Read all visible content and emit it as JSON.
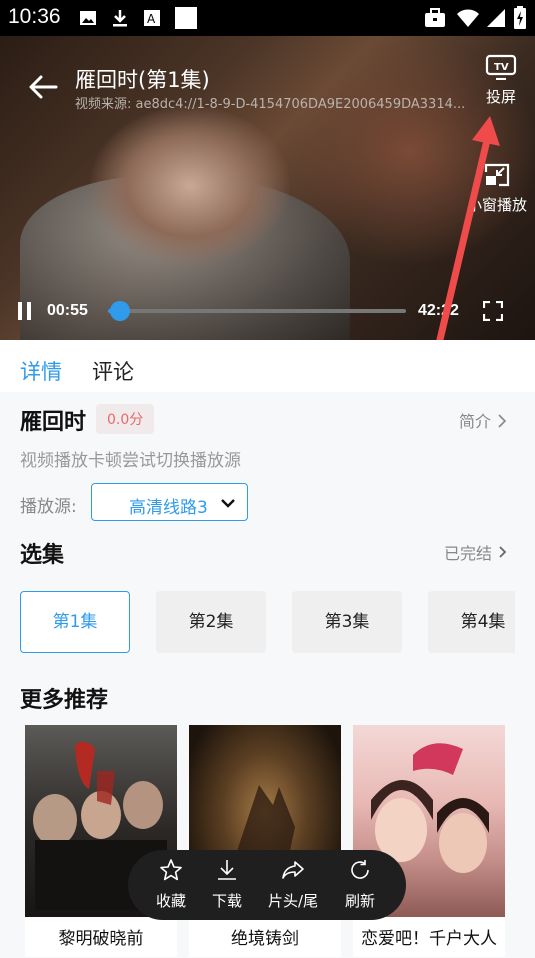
{
  "status_bar": {
    "time": "10:36"
  },
  "player": {
    "title": "雁回时(第1集)",
    "source_text": "视频来源:  ae8dc4://1-8-9-D-4154706DA9E2006459DA3314...",
    "cast_label": "投屏",
    "float_label": "小窗播放",
    "current_time": "00:55",
    "duration": "42:22",
    "progress_fraction": 0.04
  },
  "tabs": [
    {
      "label": "详情",
      "active": true
    },
    {
      "label": "评论",
      "active": false
    }
  ],
  "detail": {
    "title": "雁回时",
    "score": "0.0分",
    "intro_label": "简介",
    "tip": "视频播放卡顿尝试切换播放源",
    "source_label": "播放源:",
    "source_value": "高清线路3"
  },
  "episodes": {
    "title": "选集",
    "status": "已完结",
    "items": [
      "第1集",
      "第2集",
      "第3集",
      "第4集"
    ],
    "active_index": 0
  },
  "recommend": {
    "title": "更多推荐",
    "items": [
      "黎明破晓前",
      "绝境铸剑",
      "恋爱吧！千户大人"
    ]
  },
  "float_bar": {
    "items": [
      "收藏",
      "下载",
      "片头/尾",
      "刷新"
    ]
  },
  "colors": {
    "accent": "#2f9bea",
    "annotation_arrow": "#ef4b4b",
    "score": "#e86a6a"
  }
}
